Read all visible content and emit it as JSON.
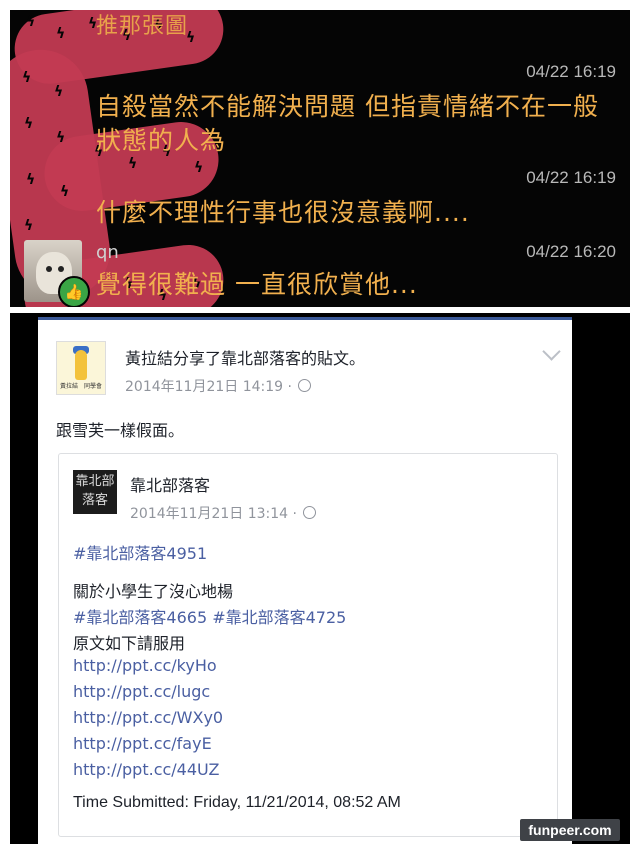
{
  "chat": {
    "title_partial": "推那張圖",
    "messages": [
      {
        "time": "04/22 16:19",
        "text": "自殺當然不能解決問題 但指責情緒不在一般狀態的人為"
      },
      {
        "time": "04/22 16:19",
        "text": "什麼不理性行事也很沒意義啊...."
      },
      {
        "user": "qn",
        "time": "04/22 16:20",
        "text": "覺得很難過 一直很欣賞他..."
      }
    ]
  },
  "post": {
    "header": "黃拉結分享了靠北部落客的貼文。",
    "timestamp": "2014年11月21日 14:19 ·",
    "text": "跟雪芙一樣假面。",
    "shared": {
      "page_avatar_text": "靠北部落客",
      "page_name": "靠北部落客",
      "timestamp": "2014年11月21日 13:14 ·",
      "hashtag": "#靠北部落客4951",
      "line1": "關於小學生了沒心地楊",
      "hashtags2": "#靠北部落客4665 #靠北部落客4725",
      "line2": "原文如下請服用",
      "links": [
        "http://ppt.cc/kyHo",
        "http://ppt.cc/lugc",
        "http://ppt.cc/WXy0",
        "http://ppt.cc/fayE",
        "http://ppt.cc/44UZ"
      ],
      "submitted": "Time Submitted: Friday, 11/21/2014, 08:52 AM"
    }
  },
  "watermark": "funpeer.com",
  "colors": {
    "chat_bg": "#050505",
    "chat_text": "#f1b04e",
    "pattern": "#c23a52",
    "fb_blue": "#3b5998",
    "link": "#4a5fa2"
  }
}
